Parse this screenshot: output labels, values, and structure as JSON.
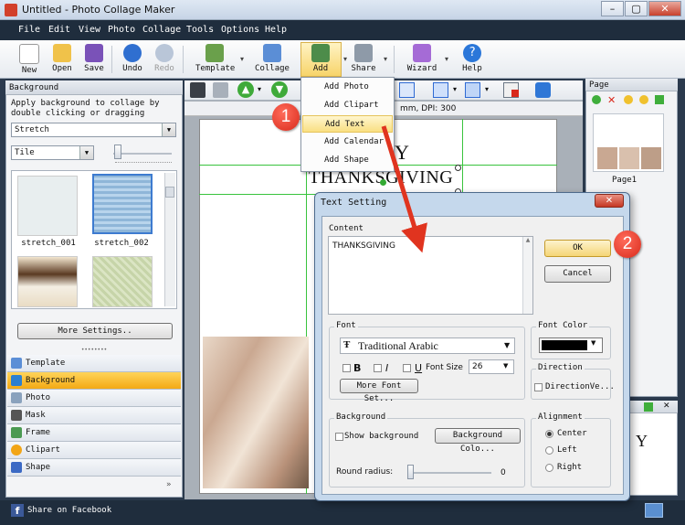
{
  "window": {
    "title": "Untitled - Photo Collage Maker",
    "min_btn": "–",
    "max_btn": "▢",
    "close_btn": "✕"
  },
  "menu": [
    "File",
    "Edit",
    "View",
    "Photo",
    "Collage",
    "Tools",
    "Options",
    "Help"
  ],
  "toolbar": {
    "new": "New",
    "open": "Open",
    "save": "Save",
    "undo": "Undo",
    "redo": "Redo",
    "template": "Template",
    "collage": "Collage",
    "add": "Add",
    "share": "Share",
    "wizard": "Wizard",
    "help": "Help"
  },
  "add_menu": [
    "Add Photo",
    "Add Clipart",
    "Add Text",
    "Add Calendar",
    "Add Shape"
  ],
  "left_panel": {
    "header": "Background",
    "instruction": "Apply background to collage by double clicking or dragging",
    "mode_select": "Stretch",
    "tile_select": "Tile",
    "thumbnails": [
      {
        "label": "stretch_001"
      },
      {
        "label": "stretch_002"
      }
    ],
    "more_settings": "More Settings..",
    "nav": [
      "Template",
      "Background",
      "Photo",
      "Mask",
      "Frame",
      "Clipart",
      "Shape"
    ],
    "share_facebook": "Share on Facebook"
  },
  "canvas": {
    "ruler_info": "mm, DPI: 300",
    "text_y": "Y",
    "text_thanks": "THANKSGIVING"
  },
  "right_panel": {
    "header": "Page",
    "page_label": "Page1",
    "preview_text": "Y"
  },
  "dialog": {
    "title": "Text Setting",
    "content_label": "Content",
    "content_value": "THANKSGIVING",
    "ok": "OK",
    "cancel": "Cancel",
    "font_label": "Font",
    "font_name": "Traditional Arabic",
    "bold": "B",
    "italic": "I",
    "underline": "U",
    "font_size_label": "Font Size",
    "font_size": "26",
    "more_font": "More Font Set...",
    "font_color_label": "Font Color",
    "direction_label": "Direction",
    "direction_check": "DirectionVe...",
    "background_label": "Background",
    "show_background": "Show background",
    "background_color_btn": "Background Colo...",
    "round_radius_label": "Round radius:",
    "round_radius_value": "0",
    "alignment_label": "Alignment",
    "align_options": [
      "Center",
      "Left",
      "Right"
    ]
  },
  "annotations": {
    "badge1": "1",
    "badge2": "2"
  }
}
